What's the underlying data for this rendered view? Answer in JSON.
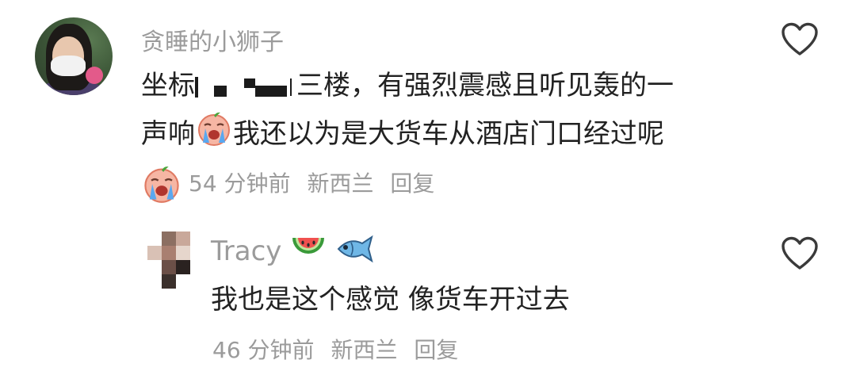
{
  "comment": {
    "username": "贪睡的小狮子",
    "text_line1_prefix": "坐标",
    "text_line1_suffix": "三楼，有强烈震感且听见轰的一",
    "text_line2_prefix": "声响",
    "text_line2_suffix": "我还以为是大货车从酒店门口经过呢",
    "time": "54 分钟前",
    "location": "新西兰",
    "reply_label": "回复"
  },
  "reply": {
    "username": "Tracy",
    "text": "我也是这个感觉 像货车开过去",
    "time": "46 分钟前",
    "location": "新西兰",
    "reply_label": "回复"
  },
  "icons": {
    "like": "heart-outline-icon",
    "crying_emoji": "loudly-crying-face-emoji",
    "watermelon": "watermelon-emoji",
    "fish": "fish-emoji"
  },
  "colors": {
    "text": "#222222",
    "secondary": "#9b9b9b",
    "background": "#ffffff"
  }
}
